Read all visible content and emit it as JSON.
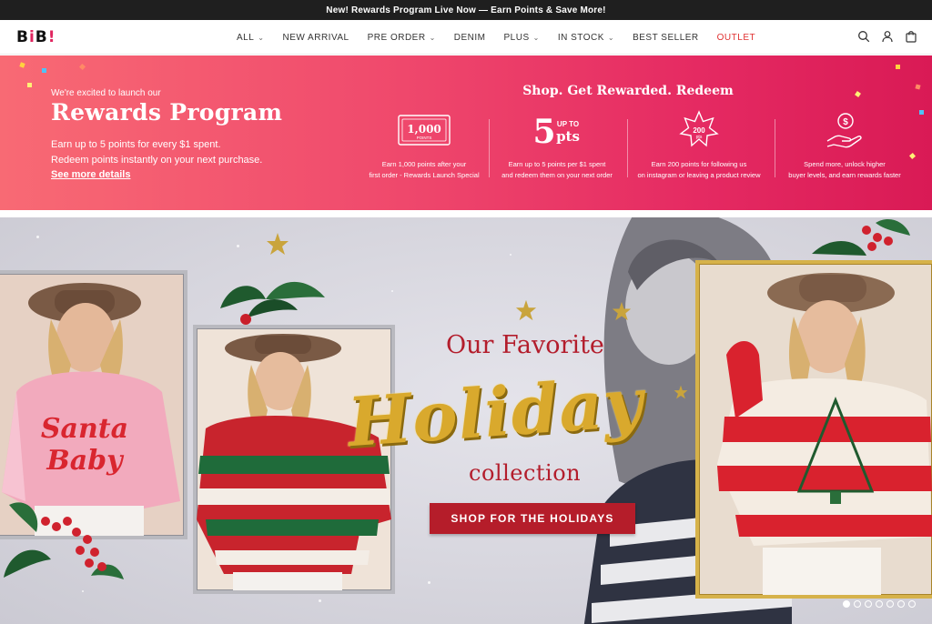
{
  "announcement": {
    "text": "New! Rewards Program Live Now — Earn Points & Save More!"
  },
  "header": {
    "logo": "BIB!",
    "nav": [
      {
        "label": "ALL",
        "dropdown": true
      },
      {
        "label": "NEW ARRIVAL",
        "dropdown": false
      },
      {
        "label": "PRE ORDER",
        "dropdown": true
      },
      {
        "label": "DENIM",
        "dropdown": false
      },
      {
        "label": "PLUS",
        "dropdown": true
      },
      {
        "label": "IN STOCK",
        "dropdown": true
      },
      {
        "label": "BEST SELLER",
        "dropdown": false
      },
      {
        "label": "OUTLET",
        "dropdown": false
      }
    ],
    "icons": [
      "search-icon",
      "account-icon",
      "cart-icon"
    ]
  },
  "rewards": {
    "intro": "We're excited to launch our",
    "title": "Rewards Program",
    "desc_line1": "Earn up to 5 points for every $1 spent.",
    "desc_line2": "Redeem points instantly on  your next purchase.",
    "link": "See more details",
    "heading": "Shop. Get Rewarded. Redeem",
    "features": [
      {
        "icon": "points-ticket-icon",
        "icon_text": "1,000",
        "icon_sub": "POINTS",
        "line1": "Earn 1,000 points after your",
        "line2": "first order - Rewards Launch Special"
      },
      {
        "icon": "five-points-icon",
        "icon_text": "5",
        "icon_sub": "UP TO",
        "icon_unit": "pts",
        "line1": "Earn up to 5 points per $1 spent",
        "line2": "and redeem them on your next order"
      },
      {
        "icon": "badge-200-icon",
        "icon_text": "200",
        "icon_sub": "pts",
        "line1": "Earn 200 points for following us",
        "line2": "on instagram or leaving a product review"
      },
      {
        "icon": "coin-hand-icon",
        "line1": "Spend more, unlock higher",
        "line2": "buyer levels, and earn rewards faster"
      }
    ]
  },
  "hero": {
    "line1": "Our Favorite",
    "line2": "Holiday",
    "line3": "collection",
    "cta": "SHOP FOR THE HOLIDAYS",
    "slides": 7,
    "active_slide": 1
  },
  "colors": {
    "announce_bg": "#1f1f1f",
    "rewards_start": "#f86a74",
    "rewards_end": "#d91a55",
    "outlet": "#e03030",
    "hero_red": "#b31d2c",
    "hero_gold": "#d9a92d"
  }
}
